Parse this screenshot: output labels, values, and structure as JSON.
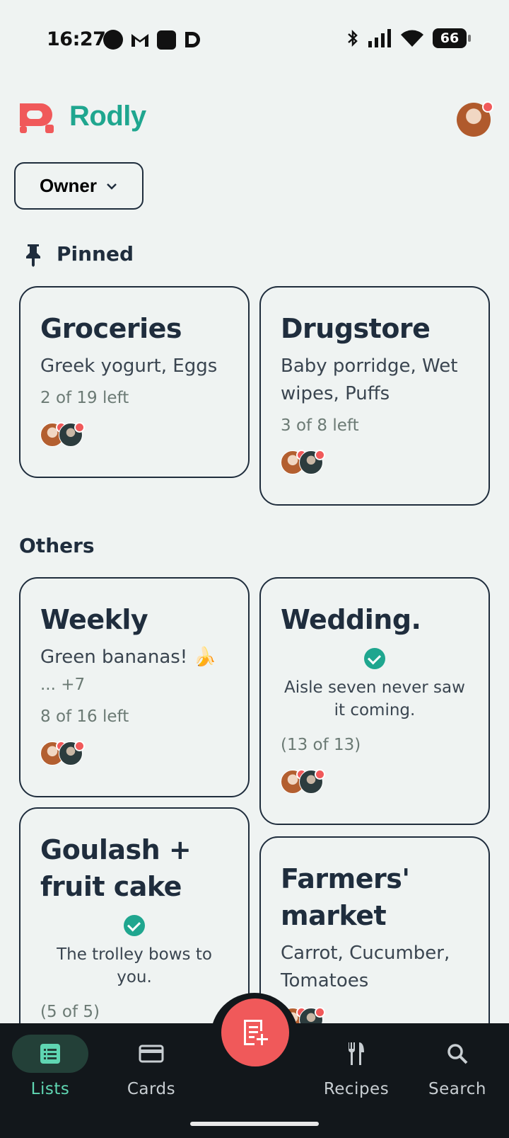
{
  "status_bar": {
    "time": "16:27",
    "battery": "66"
  },
  "header": {
    "app_name": "Rodly"
  },
  "filter": {
    "label": "Owner"
  },
  "sections": {
    "pinned": "Pinned",
    "others": "Others"
  },
  "cards": {
    "groceries": {
      "title": "Groceries",
      "items": "Greek yogurt, Eggs",
      "count": "2 of 19 left"
    },
    "drugstore": {
      "title": "Drugstore",
      "items": "Baby porridge, Wet wipes, Puffs",
      "count": "3 of 8 left"
    },
    "weekly": {
      "title": "Weekly",
      "items": "Green bananas! 🍌",
      "more": "... +7",
      "count": "8 of 16 left"
    },
    "wedding": {
      "title": "Wedding.",
      "quote": "Aisle seven never saw it coming.",
      "count": "(13 of 13)"
    },
    "goulash": {
      "title": "Goulash + fruit cake",
      "quote": "The trolley bows to you.",
      "count": "(5 of 5)"
    },
    "farmers": {
      "title": "Farmers' market",
      "items": "Carrot, Cucumber, Tomatoes"
    }
  },
  "nav": {
    "lists": "Lists",
    "cards": "Cards",
    "recipes": "Recipes",
    "search": "Search"
  },
  "colors": {
    "brand": "#1fa68f",
    "accent": "#f0595a",
    "background": "#eff3f2",
    "nav_bg": "#12171b"
  }
}
